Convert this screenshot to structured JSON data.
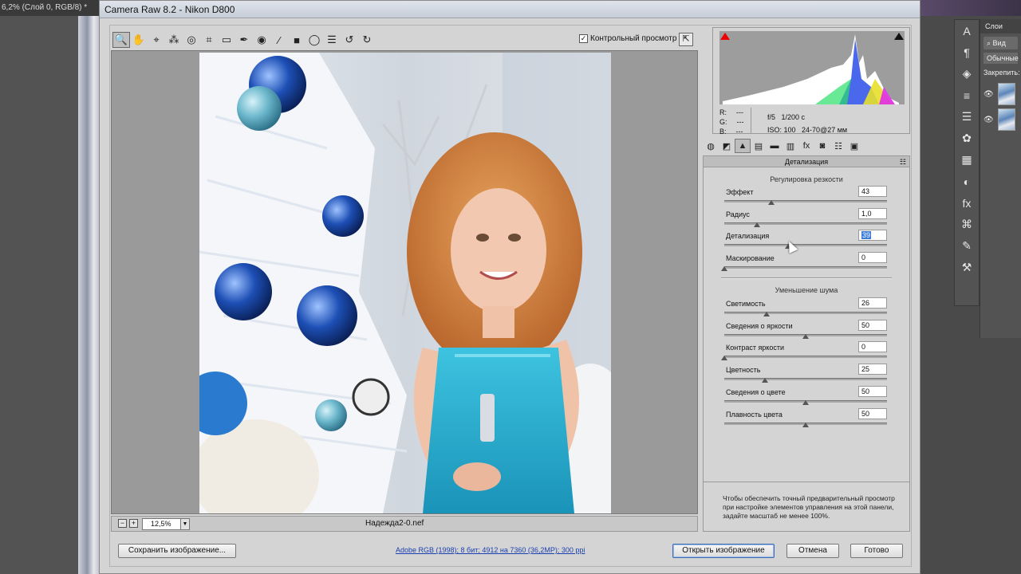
{
  "photoshop": {
    "doc_tab": "6,2% (Слой 0, RGB/8) *",
    "layers_tab": "Слои",
    "search_label": "Вид",
    "blend_mode": "Обычные",
    "lock_label": "Закрепить:"
  },
  "dialog": {
    "title": "Camera Raw 8.2  -  Nikon D800",
    "preview_label": "Контрольный просмотр",
    "preview_checked": true,
    "zoom": "12,5%",
    "filename": "Надежда2-0.nef"
  },
  "histogram": {
    "r_label": "R:",
    "g_label": "G:",
    "b_label": "B:",
    "r": "---",
    "g": "---",
    "b": "---",
    "aperture": "f/5",
    "shutter": "1/200 с",
    "iso": "ISO: 100",
    "lens": "24-70@27 мм"
  },
  "panel": {
    "title": "Детализация",
    "sharpening_title": "Регулировка резкости",
    "noise_title": "Уменьшение шума",
    "hint": "Чтобы обеспечить точный предварительный просмотр при настройке элементов управления на этой панели, задайте масштаб не менее 100%.",
    "sharpening": [
      {
        "label": "Эффект",
        "value": "43",
        "fraction": 0.29
      },
      {
        "label": "Радиус",
        "value": "1,0",
        "fraction": 0.2
      },
      {
        "label": "Детализация",
        "value": "39",
        "fraction": 0.39,
        "selected": true
      },
      {
        "label": "Маскирование",
        "value": "0",
        "fraction": 0.0
      }
    ],
    "noise": [
      {
        "label": "Светимость",
        "value": "26",
        "fraction": 0.26
      },
      {
        "label": "Сведения о яркости",
        "value": "50",
        "fraction": 0.5
      },
      {
        "label": "Контраст яркости",
        "value": "0",
        "fraction": 0.0
      },
      {
        "label": "Цветность",
        "value": "25",
        "fraction": 0.25
      },
      {
        "label": "Сведения о цвете",
        "value": "50",
        "fraction": 0.5
      },
      {
        "label": "Плавность цвета",
        "value": "50",
        "fraction": 0.5
      }
    ]
  },
  "buttons": {
    "save": "Сохранить изображение...",
    "workflow": "Adobe RGB (1998); 8 бит; 4912 на 7360 (36,2МР); 300 ppi",
    "open": "Открыть изображение",
    "cancel": "Отмена",
    "done": "Готово"
  },
  "icons": {
    "toolbar": [
      "zoom-tool-icon",
      "hand-tool-icon",
      "white-balance-icon",
      "color-sampler-icon",
      "targeted-adjust-icon",
      "crop-icon",
      "straighten-icon",
      "spot-removal-icon",
      "red-eye-icon",
      "adjustment-brush-icon",
      "graduated-filter-icon",
      "radial-filter-icon",
      "preferences-icon",
      "rotate-left-icon",
      "rotate-right-icon"
    ],
    "panel_tabs": [
      "basic-icon",
      "tone-curve-icon",
      "detail-icon",
      "hsl-icon",
      "split-toning-icon",
      "lens-corrections-icon",
      "effects-icon",
      "camera-calibration-icon",
      "presets-icon",
      "snapshots-icon"
    ]
  },
  "colors": {
    "accent": "#3b7dd8",
    "dialog_bg": "#d4d4d4",
    "link": "#1a3fb0"
  }
}
